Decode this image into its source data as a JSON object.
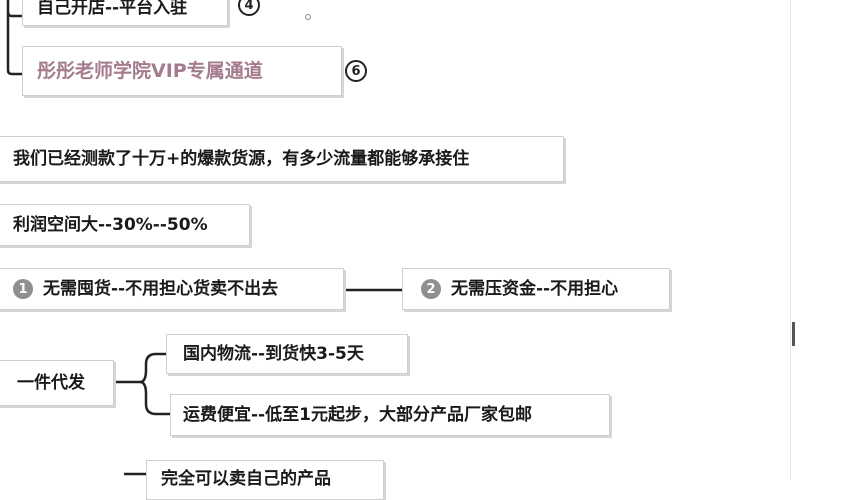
{
  "nodes": {
    "top_partial": "自己开店--平台入驻",
    "vip_channel": "彤彤老师学院VIP专属通道",
    "tested_sources": "我们已经测款了十万+的爆款货源，有多少流量都能够承接住",
    "profit_margin": "利润空间大--30%--50%",
    "no_stock": "无需囤货--不用担心货卖不出去",
    "no_capital": "无需压资金--不用担心",
    "dropshipping": "一件代发",
    "domestic_logistics": "国内物流--到货快3-5天",
    "cheap_shipping": "运费便宜--低至1元起步，大部分产品厂家包邮",
    "bottom_partial": "完全可以卖自己的产品"
  },
  "badges": {
    "top_num": "4",
    "vip_num": "6",
    "no_stock_num": "1",
    "no_capital_num": "2"
  },
  "colors": {
    "accent_pink": "#a47c8d",
    "badge_gray": "#8f8f8f",
    "connector": "#222222"
  }
}
